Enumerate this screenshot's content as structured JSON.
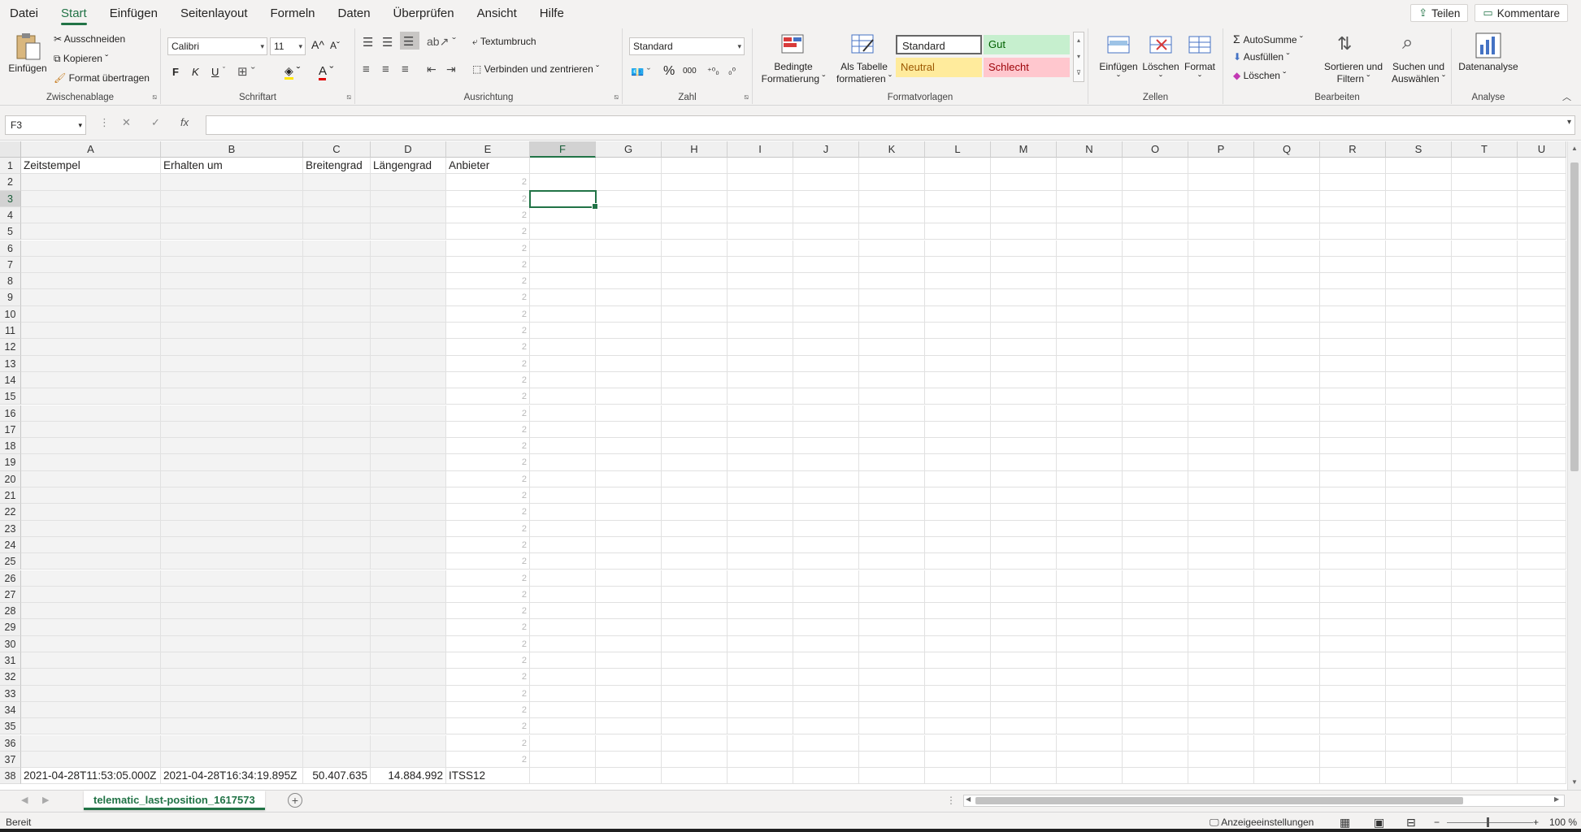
{
  "tabs": [
    "Datei",
    "Start",
    "Einfügen",
    "Seitenlayout",
    "Formeln",
    "Daten",
    "Überprüfen",
    "Ansicht",
    "Hilfe"
  ],
  "top_buttons": {
    "share": "Teilen",
    "comments": "Kommentare"
  },
  "ribbon": {
    "clipboard": {
      "paste": "Einfügen",
      "cut": "Ausschneiden",
      "copy": "Kopieren",
      "format_painter": "Format übertragen",
      "label": "Zwischenablage"
    },
    "font": {
      "name": "Calibri",
      "size": "11",
      "bold": "F",
      "italic": "K",
      "underline": "U",
      "grow": "A^",
      "shrink": "Aˇ",
      "color_letter": "A",
      "label": "Schriftart"
    },
    "alignment": {
      "wrap": "Textumbruch",
      "merge": "Verbinden und zentrieren",
      "label": "Ausrichtung"
    },
    "number": {
      "format": "Standard",
      "percent": "%",
      "thousands": "000",
      "label": "Zahl"
    },
    "styles": {
      "conditional": [
        "Bedingte",
        "Formatierung ˇ"
      ],
      "as_table": [
        "Als Tabelle",
        "formatieren ˇ"
      ],
      "standard": "Standard",
      "good": "Gut",
      "neutral": "Neutral",
      "bad": "Schlecht",
      "label": "Formatvorlagen"
    },
    "cells": {
      "insert": "Einfügen",
      "delete": "Löschen",
      "format": "Format",
      "label": "Zellen"
    },
    "editing": {
      "autosum": "AutoSumme",
      "fill": "Ausfüllen",
      "clear": "Löschen",
      "sort": [
        "Sortieren und",
        "Filtern ˇ"
      ],
      "find": [
        "Suchen und",
        "Auswählen ˇ"
      ],
      "label": "Bearbeiten"
    },
    "analysis": {
      "data_analysis": "Datenanalyse",
      "label": "Analyse"
    }
  },
  "formula_bar": {
    "name_box": "F3",
    "fx": "fx",
    "formula": ""
  },
  "columns": [
    "A",
    "B",
    "C",
    "D",
    "E",
    "F",
    "G",
    "H",
    "I",
    "J",
    "K",
    "L",
    "M",
    "N",
    "O",
    "P",
    "Q",
    "R",
    "S",
    "T",
    "U"
  ],
  "selected_column": "F",
  "selected_row": "3",
  "headers": [
    "Zeitstempel",
    "Erhalten um",
    "Breitengrad",
    "Längengrad",
    "Anbieter"
  ],
  "ghost_value": "2",
  "row_numbers": [
    "1",
    "2",
    "3",
    "4",
    "5",
    "6",
    "7",
    "8",
    "9",
    "10",
    "11",
    "12",
    "13",
    "14",
    "15",
    "16",
    "17",
    "18",
    "19",
    "20",
    "21",
    "22",
    "23",
    "24",
    "25",
    "26",
    "27",
    "28",
    "29",
    "30",
    "31",
    "32",
    "33",
    "34",
    "35",
    "36",
    "37",
    "38"
  ],
  "last_row": {
    "timestamp": "2021-04-28T11:53:05.000Z",
    "received": "2021-04-28T16:34:19.895Z",
    "lat": "50.407.635",
    "lon": "14.884.992",
    "provider": "ITSS12"
  },
  "sheet_tab": "telematic_last-position_1617573",
  "status": {
    "ready": "Bereit",
    "display_settings": "Anzeigeeinstellungen",
    "zoom": "100 %"
  }
}
